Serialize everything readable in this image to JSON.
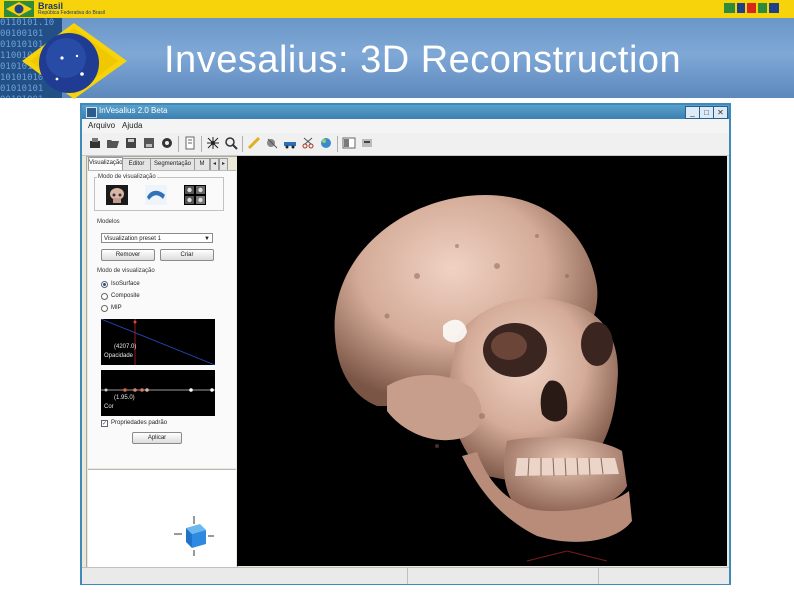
{
  "gov_bar": {
    "brasil_label": "Brasil",
    "brasil_subtitle": "Repúbica Federativa do Brasil"
  },
  "banner": {
    "binary_lines": [
      "0110101.10",
      "00100101",
      "01010101",
      "110010010",
      "01010101",
      "10101010",
      "01010101",
      "00101001"
    ],
    "slide_title": "Invesalius: 3D Reconstruction"
  },
  "window": {
    "title": "InVesalius 2.0 Beta",
    "minimize_glyph": "_",
    "maximize_glyph": "□",
    "close_glyph": "✕"
  },
  "menu": {
    "items": [
      {
        "label": "Arquivo"
      },
      {
        "label": "Ajuda"
      }
    ]
  },
  "left_panel": {
    "tabs": [
      "Visualização",
      "Editor",
      "Segmentação",
      "M"
    ],
    "tab_prev": "◂",
    "tab_next": "▸",
    "view_mode_group": "Modo de visualização",
    "models_label": "Modelos",
    "model_selected": "Visualization preset 1",
    "remove_button": "Remover",
    "create_button": "Criar",
    "render_mode_label": "Modo de visualização",
    "render_modes": [
      {
        "label": "IsoSurface",
        "checked": true
      },
      {
        "label": "Composite",
        "checked": false
      },
      {
        "label": "MIP",
        "checked": false
      }
    ],
    "opacity_value": "(4207.0)",
    "opacity_label": "Opacidade",
    "color_value": "(1.95.0)",
    "color_label": "Cor",
    "default_props_label": "Propriedades padrão",
    "default_props_checked": true,
    "apply_button": "Aplicar"
  },
  "colors": {
    "banner_blue": "#6b96c6",
    "gov_yellow": "#f6d30a",
    "window_frame": "#3e8ab8",
    "bone": "#d9b6a6"
  }
}
